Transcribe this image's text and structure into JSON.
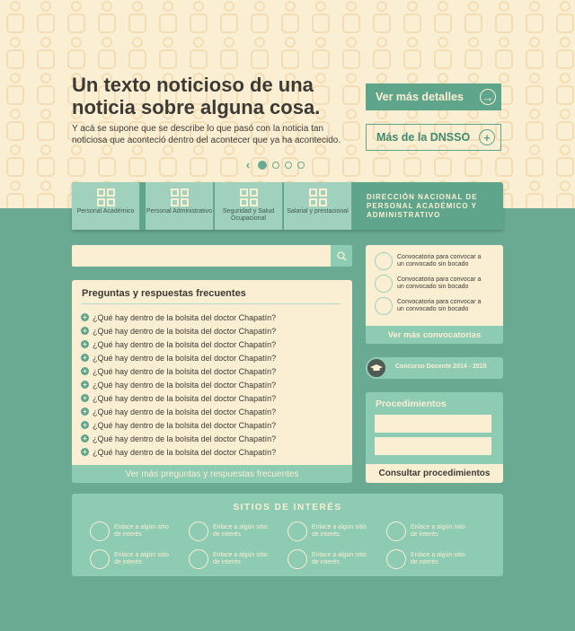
{
  "hero": {
    "headline": "Un texto noticioso de una noticia sobre alguna cosa.",
    "subtext": "Y acá se supone que se describe lo que pasó con la noticia tan noticiosa que aconteció dentro del acontecer que ya ha acontecido.",
    "details_label": "Ver más detalles",
    "dnsso_label": "Más de la DNSSO",
    "slider": {
      "count": 4,
      "active": 1
    }
  },
  "menu": {
    "items": [
      {
        "label": "Personal Académico",
        "icon": "grid-icon"
      },
      {
        "label": "Personal Administrativo",
        "icon": "grid-icon"
      },
      {
        "label": "Seguridad y Salud Ocupacional",
        "icon": "grid-icon"
      },
      {
        "label": "Salarial y prestacional",
        "icon": "grid-icon"
      }
    ],
    "title": "DIRECCIÓN NACIONAL DE PERSONAL ACADÉMICO Y ADMINISTRATIVO"
  },
  "search": {
    "placeholder": "",
    "icon": "search-icon"
  },
  "faq": {
    "title": "Preguntas y respuestas frecuentes",
    "items": [
      "¿Qué hay dentro de la bolsita del doctor Chapatín?",
      "¿Qué hay dentro de la bolsita del doctor Chapatín?",
      "¿Qué hay dentro de la bolsita del doctor Chapatín?",
      "¿Qué hay dentro de la bolsita del doctor Chapatín?",
      "¿Qué hay dentro de la bolsita del doctor Chapatín?",
      "¿Qué hay dentro de la bolsita del doctor Chapatín?",
      "¿Qué hay dentro de la bolsita del doctor Chapatín?",
      "¿Qué hay dentro de la bolsita del doctor Chapatín?",
      "¿Qué hay dentro de la bolsita del doctor Chapatín?",
      "¿Qué hay dentro de la bolsita del doctor Chapatín?",
      "¿Qué hay dentro de la bolsita del doctor Chapatín?"
    ],
    "more_label": "Ver más preguntas y respuestas frecuentes"
  },
  "convocatorias": {
    "items": [
      "Convocatoria para convocar a un convocado sin bocado",
      "Convocatoria para convocar a un convocado sin bocado",
      "Convocatoria para convocar a un convocado sin bocado"
    ],
    "more_label": "Ver más convocatorias"
  },
  "concurso": {
    "label": "Concurso Docente 2014 - 2015",
    "icon": "graduation-cap-icon"
  },
  "procedimientos": {
    "title": "Procedimientos",
    "button_label": "Consultar procedimientos"
  },
  "sitios": {
    "title": "SITIOS DE INTERÉS",
    "links": [
      "Enlace a algún sitio de interés",
      "Enlace a algún sitio de interés",
      "Enlace a algún sitio de interés",
      "Enlace a algún sitio de interés",
      "Enlace a algún sitio de interés",
      "Enlace a algún sitio de interés",
      "Enlace a algún sitio de interés",
      "Enlace a algún sitio de interés"
    ]
  },
  "colors": {
    "cream": "#fbefd3",
    "green": "#6aaa93",
    "mint": "#8dcbb3",
    "text": "#3d3a35"
  }
}
